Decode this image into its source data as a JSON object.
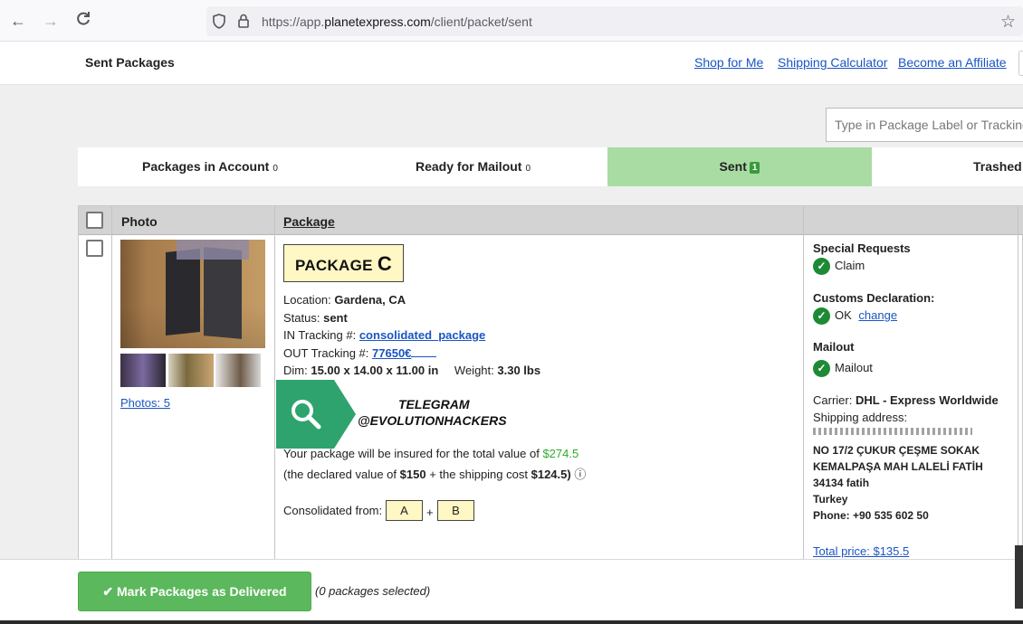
{
  "browser": {
    "url_prefix": "https://app.",
    "url_domain": "planetexpress.com",
    "url_path": "/client/packet/sent",
    "icons": [
      "back-arrow-icon",
      "forward-arrow-icon",
      "reload-icon",
      "shield-icon",
      "lock-icon",
      "star-icon"
    ]
  },
  "header": {
    "title": "Sent Packages",
    "links": [
      "Shop for Me",
      "Shipping Calculator",
      "Become an Affiliate"
    ]
  },
  "search": {
    "placeholder": "Type in Package Label or Tracking"
  },
  "tabs": [
    {
      "label": "Packages in Account",
      "count": "0"
    },
    {
      "label": "Ready for Mailout",
      "count": "0"
    },
    {
      "label": "Sent",
      "count": "1",
      "active": true
    },
    {
      "label": "Trashed"
    }
  ],
  "table": {
    "headers": {
      "photo": "Photo",
      "package": "Package"
    },
    "package": {
      "photos_link": "Photos: 5",
      "label_prefix": "PACKAGE",
      "label_letter": "C",
      "location_label": "Location:",
      "location": "Gardena, CA",
      "status_label": "Status:",
      "status": "sent",
      "in_tracking_label": "IN Tracking #:",
      "in_tracking": "consolidated_package",
      "out_tracking_label": "OUT Tracking #:",
      "out_tracking": "77650€",
      "dim_label": "Dim:",
      "dim": "15.00 x 14.00 x 11.00 in",
      "weight_label": "Weight:",
      "weight": "3.30 lbs",
      "insured_text": "Your package will be insured for the total value of",
      "insured_value": "$274.5",
      "declared_pre": "(the declared value of",
      "declared_value": "$150",
      "declared_mid": "+ the shipping cost",
      "shipping_cost": "$124.5)",
      "info_icon": "ⓘ",
      "consolidated_label": "Consolidated from:",
      "consolidated": [
        "A",
        "B"
      ],
      "plus": "+"
    },
    "side": {
      "special_requests": "Special Requests",
      "claim": "Claim",
      "customs": "Customs Declaration:",
      "customs_status": "OK",
      "customs_change": "change",
      "mailout": "Mailout",
      "mailout_status": "Mailout",
      "carrier_label": "Carrier:",
      "carrier": "DHL - Express Worldwide",
      "shipping_address_label": "Shipping address:",
      "address_lines": [
        "NO 17/2 ÇUKUR ÇEŞME SOKAK",
        "KEMALPAŞA MAH LALELİ FATİH",
        "34134 fatih",
        "Turkey",
        "Phone: +90 535 602 50"
      ],
      "total_price": "Total price: $135.5"
    }
  },
  "overlay": {
    "line1": "TELEGRAM",
    "line2": "@EVOLUTIONHACKERS"
  },
  "footer": {
    "button": "Mark Packages as Delivered",
    "selected_note": "(0 packages selected)"
  },
  "colors": {
    "accent_green": "#5cb85c",
    "tab_active": "#a9dca3",
    "link": "#1a55c4",
    "label_bg": "#fff7c4"
  }
}
